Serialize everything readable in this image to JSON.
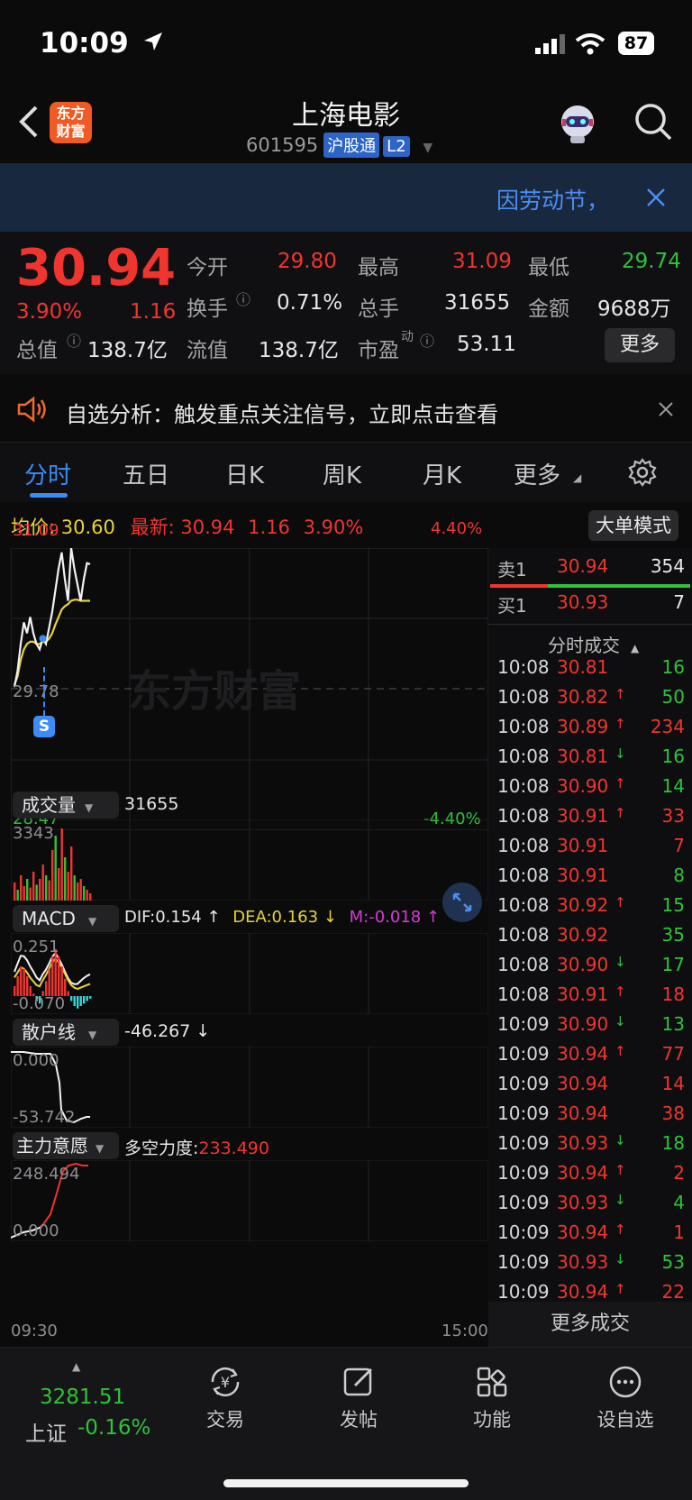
{
  "status_bar": {
    "time": "10:09",
    "battery": "87"
  },
  "header": {
    "back_icon": "chevron-left-icon",
    "app_logo": "东方\n财富",
    "title": "上海电影",
    "code": "601595",
    "market_badge": "沪股通",
    "level_badge": "L2",
    "search_icon": "search-icon",
    "assistant_icon": "robot-avatar-icon"
  },
  "banner": {
    "text": "因劳动节，",
    "close_icon": "close-icon"
  },
  "quote": {
    "price": "30.94",
    "change_pct": "3.90%",
    "change": "1.16",
    "open_label": "今开",
    "open": "29.80",
    "high_label": "最高",
    "high": "31.09",
    "low_label": "最低",
    "low": "29.74",
    "turnover_label": "换手",
    "turnover": "0.71%",
    "volume_label": "总手",
    "volume": "31655",
    "amount_label": "金额",
    "amount": "9688万",
    "mktcap_label": "总值",
    "mktcap": "138.7亿",
    "float_label": "流值",
    "float": "138.7亿",
    "pe_label": "市盈",
    "pe_sup": "动",
    "pe": "53.11",
    "more_button": "更多"
  },
  "alert": {
    "text": "自选分析：触发重点关注信号，立即点击查看",
    "speaker_icon": "speaker-icon",
    "close_icon": "close-icon"
  },
  "tabs": [
    {
      "label": "分时"
    },
    {
      "label": "五日"
    },
    {
      "label": "日K"
    },
    {
      "label": "周K"
    },
    {
      "label": "月K"
    },
    {
      "label": "更多"
    }
  ],
  "settings_icon": "gear-icon",
  "chart_info": {
    "avg_label": "均价:",
    "avg": "30.60",
    "latest_label": "最新:",
    "latest": "30.94",
    "latest_chg": "1.16",
    "latest_pct": "3.90%",
    "big_order_button": "大单模式",
    "watermark": "东方财富"
  },
  "chart_data": {
    "type": "line",
    "y_top": "31.09",
    "y_mid": "29.78",
    "y_bottom": "28.47",
    "pct_top": "4.40%",
    "pct_bottom": "-4.40%",
    "x_start": "09:30",
    "x_end": "15:00",
    "ylim": [
      28.47,
      31.09
    ],
    "price_series": [
      29.8,
      29.95,
      30.2,
      30.4,
      30.3,
      30.45,
      30.3,
      30.2,
      30.15,
      30.25,
      30.2,
      30.35,
      30.5,
      30.7,
      30.9,
      31.05,
      30.8,
      30.6,
      31.09,
      30.9,
      30.75,
      30.6,
      30.8,
      30.95,
      30.94
    ],
    "avg_series": [
      29.82,
      29.9,
      30.05,
      30.15,
      30.2,
      30.22,
      30.22,
      30.2,
      30.2,
      30.22,
      30.22,
      30.25,
      30.3,
      30.38,
      30.45,
      30.52,
      30.55,
      30.57,
      30.6,
      30.61,
      30.61,
      30.6,
      30.6,
      30.6,
      30.6
    ],
    "signal_marker": "S",
    "volume": {
      "label": "成交量",
      "total": "31655",
      "max_label": "3343",
      "bars": [
        0.25,
        0.15,
        0.35,
        0.2,
        0.3,
        0.18,
        0.4,
        0.22,
        0.3,
        0.5,
        0.35,
        0.28,
        0.7,
        0.9,
        0.45,
        1.0,
        0.6,
        0.4,
        0.75,
        0.35,
        0.25,
        0.3,
        0.2,
        0.15,
        0.1
      ]
    },
    "macd": {
      "label": "MACD",
      "dif": "DIF:0.154 ↑",
      "dea": "DEA:0.163 ↓",
      "m": "M:-0.018 ↑",
      "top": "0.251",
      "bottom": "-0.070",
      "bars": [
        0.2,
        0.4,
        0.6,
        0.55,
        0.4,
        0.2,
        0.05,
        -0.1,
        -0.15,
        0.1,
        0.3,
        0.55,
        0.8,
        0.95,
        0.8,
        0.6,
        0.35,
        0.1,
        -0.1,
        -0.2,
        -0.25,
        -0.2,
        -0.15,
        -0.1,
        -0.05
      ]
    },
    "retail": {
      "label": "散户线",
      "value": "-46.267 ↓",
      "top": "0.000",
      "bottom": "-53.742"
    },
    "main": {
      "label": "主力意愿",
      "sub_label": "多空力度:",
      "value": "233.490",
      "top": "248.494",
      "bottom": "0.000"
    }
  },
  "order_book": {
    "sell1_label": "卖1",
    "sell1_price": "30.94",
    "sell1_vol": "354",
    "buy1_label": "买1",
    "buy1_price": "30.93",
    "buy1_vol": "7"
  },
  "ticks_header": "分时成交",
  "ticks": [
    {
      "t": "10:08",
      "p": "30.81",
      "d": "",
      "v": "16",
      "vc": "green"
    },
    {
      "t": "10:08",
      "p": "30.82",
      "d": "↑",
      "v": "50",
      "vc": "green"
    },
    {
      "t": "10:08",
      "p": "30.89",
      "d": "↑",
      "v": "234",
      "vc": "red"
    },
    {
      "t": "10:08",
      "p": "30.81",
      "d": "↓",
      "v": "16",
      "vc": "green"
    },
    {
      "t": "10:08",
      "p": "30.90",
      "d": "↑",
      "v": "14",
      "vc": "green"
    },
    {
      "t": "10:08",
      "p": "30.91",
      "d": "↑",
      "v": "33",
      "vc": "red"
    },
    {
      "t": "10:08",
      "p": "30.91",
      "d": "",
      "v": "7",
      "vc": "red"
    },
    {
      "t": "10:08",
      "p": "30.91",
      "d": "",
      "v": "8",
      "vc": "green"
    },
    {
      "t": "10:08",
      "p": "30.92",
      "d": "↑",
      "v": "15",
      "vc": "green"
    },
    {
      "t": "10:08",
      "p": "30.92",
      "d": "",
      "v": "35",
      "vc": "green"
    },
    {
      "t": "10:08",
      "p": "30.90",
      "d": "↓",
      "v": "17",
      "vc": "green"
    },
    {
      "t": "10:08",
      "p": "30.91",
      "d": "↑",
      "v": "18",
      "vc": "red"
    },
    {
      "t": "10:09",
      "p": "30.90",
      "d": "↓",
      "v": "13",
      "vc": "green"
    },
    {
      "t": "10:09",
      "p": "30.94",
      "d": "↑",
      "v": "77",
      "vc": "red"
    },
    {
      "t": "10:09",
      "p": "30.94",
      "d": "",
      "v": "14",
      "vc": "red"
    },
    {
      "t": "10:09",
      "p": "30.94",
      "d": "",
      "v": "38",
      "vc": "red"
    },
    {
      "t": "10:09",
      "p": "30.93",
      "d": "↓",
      "v": "18",
      "vc": "green"
    },
    {
      "t": "10:09",
      "p": "30.94",
      "d": "↑",
      "v": "2",
      "vc": "red"
    },
    {
      "t": "10:09",
      "p": "30.93",
      "d": "↓",
      "v": "4",
      "vc": "green"
    },
    {
      "t": "10:09",
      "p": "30.94",
      "d": "↑",
      "v": "1",
      "vc": "red"
    },
    {
      "t": "10:09",
      "p": "30.93",
      "d": "↓",
      "v": "53",
      "vc": "green"
    },
    {
      "t": "10:09",
      "p": "30.94",
      "d": "↑",
      "v": "22",
      "vc": "red"
    }
  ],
  "more_ticks_button": "更多成交",
  "bottom_nav": {
    "index_value": "3281.51",
    "index_name": "上证",
    "index_change": "-0.16%",
    "items": [
      {
        "label": "交易",
        "icon": "yuan-exchange-icon"
      },
      {
        "label": "发帖",
        "icon": "edit-icon"
      },
      {
        "label": "功能",
        "icon": "grid-icon"
      },
      {
        "label": "设自选",
        "icon": "more-dots-icon"
      }
    ]
  },
  "colors": {
    "up": "#f0352f",
    "down": "#2fc23a",
    "accent": "#3b8cf5",
    "avg_line": "#e8d23a"
  }
}
